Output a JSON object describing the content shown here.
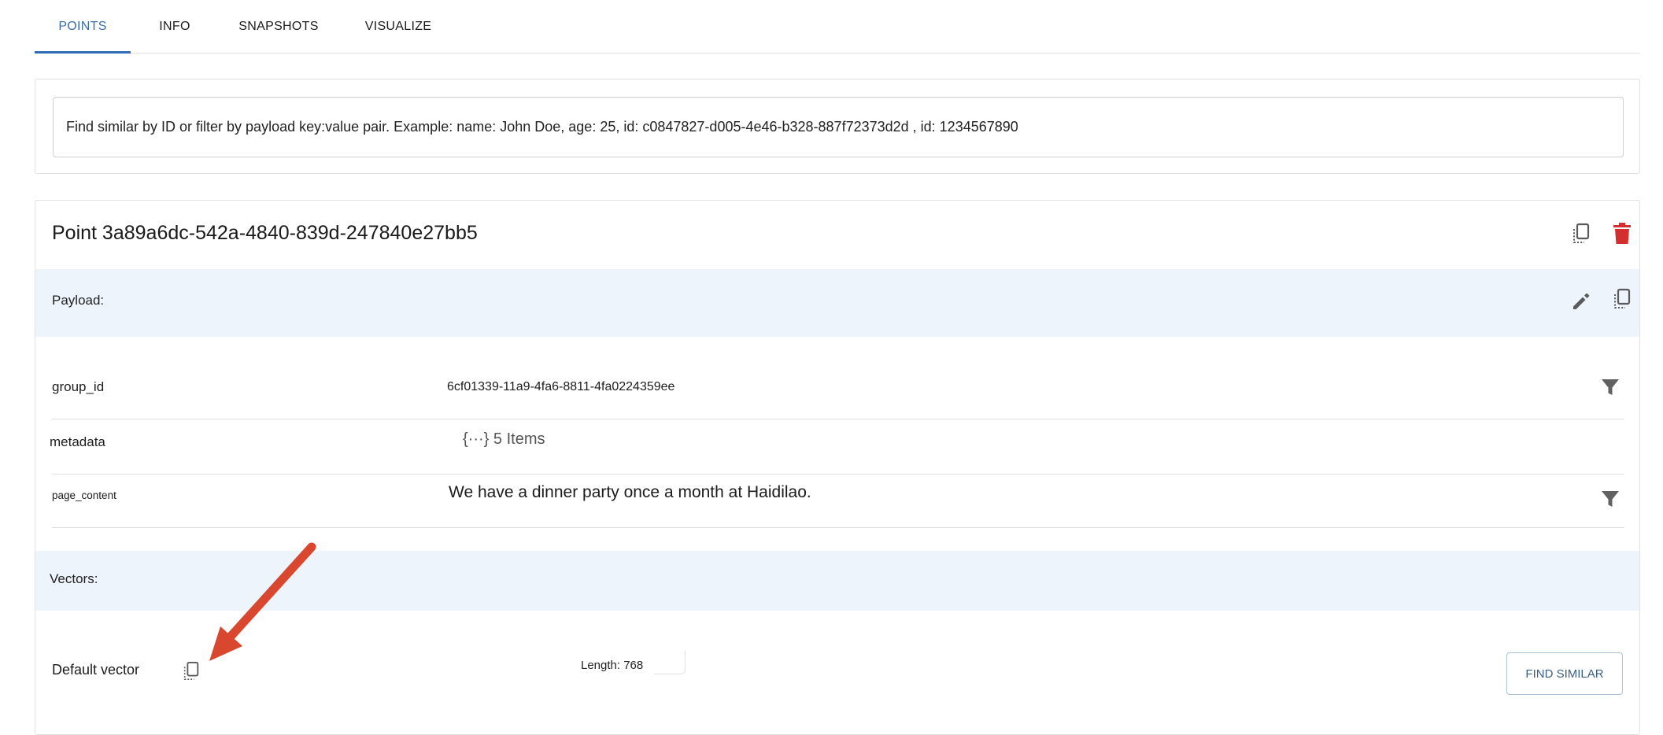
{
  "tabs": [
    {
      "label": "POINTS",
      "active": true
    },
    {
      "label": "INFO",
      "active": false
    },
    {
      "label": "SNAPSHOTS",
      "active": false
    },
    {
      "label": "VISUALIZE",
      "active": false
    }
  ],
  "search": {
    "placeholder": "Find similar by ID or filter by payload key:value pair. Example: name: John Doe, age: 25, id: c0847827-d005-4e46-b328-887f72373d2d , id: 1234567890"
  },
  "point": {
    "title": "Point 3a89a6dc-542a-4840-839d-247840e27bb5",
    "payload_label": "Payload:",
    "payload": [
      {
        "key": "group_id",
        "value": "6cf01339-11a9-4fa6-8811-4fa0224359ee",
        "filter": true
      },
      {
        "key": "metadata",
        "value": "{···} 5 Items",
        "filter": false
      },
      {
        "key": "page_content",
        "value": "We have a dinner party once a month at Haidilao.",
        "filter": true
      }
    ],
    "vectors_label": "Vectors:",
    "vector": {
      "name": "Default vector",
      "length_label": "Length: 768",
      "find_similar_label": "FIND SIMILAR"
    }
  },
  "colors": {
    "accent": "#2f6db5",
    "delete": "#d32f2f",
    "band": "#eef4fc",
    "annotation_arrow": "#d9472f"
  },
  "icons": [
    "copy-icon",
    "delete-icon",
    "edit-icon",
    "filter-icon"
  ]
}
